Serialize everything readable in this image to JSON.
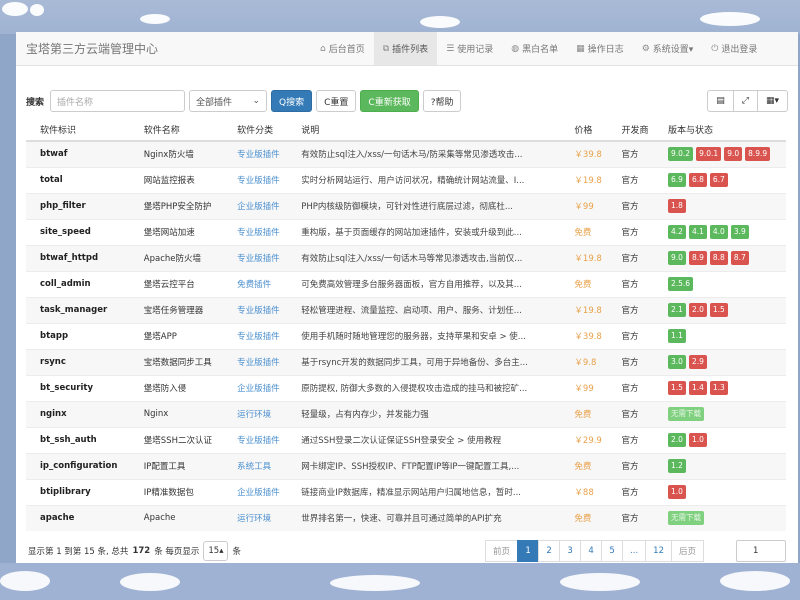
{
  "app": {
    "title": "宝塔第三方云端管理中心"
  },
  "nav": [
    {
      "icon": "home-icon",
      "glyph": "⌂",
      "label": "后台首页",
      "active": false
    },
    {
      "icon": "cube-icon",
      "glyph": "⧉",
      "label": "插件列表",
      "active": true
    },
    {
      "icon": "list-icon",
      "glyph": "☰",
      "label": "使用记录",
      "active": false
    },
    {
      "icon": "globe-icon",
      "glyph": "◍",
      "label": "黑白名单",
      "active": false
    },
    {
      "icon": "calendar-icon",
      "glyph": "▦",
      "label": "操作日志",
      "active": false
    },
    {
      "icon": "gear-icon",
      "glyph": "⚙",
      "label": "系统设置▾",
      "active": false
    },
    {
      "icon": "power-icon",
      "glyph": "⏻",
      "label": "退出登录",
      "active": false
    }
  ],
  "toolbar": {
    "search_label": "搜索",
    "search_placeholder": "插件名称",
    "filter_value": "全部插件",
    "search_button": "Q搜索",
    "reset_button": "C重置",
    "refresh_button": "C重新获取",
    "help_button": "?帮助"
  },
  "table": {
    "headers": [
      "软件标识",
      "软件名称",
      "软件分类",
      "说明",
      "价格",
      "开发商",
      "版本与状态"
    ],
    "rows": [
      {
        "id": "btwaf",
        "name": "Nginx防火墙",
        "category": "专业版插件",
        "desc": "有效防止sql注入/xss/一句话木马/防采集等常见渗透攻击...",
        "price": "￥39.8",
        "dev": "官方",
        "versions": [
          [
            "9.0.2",
            "g"
          ],
          [
            "9.0.1",
            "r"
          ],
          [
            "9.0",
            "r"
          ],
          [
            "8.9.9",
            "r"
          ]
        ]
      },
      {
        "id": "total",
        "name": "网站监控报表",
        "category": "专业版插件",
        "desc": "实时分析网站运行、用户访问状况，精确统计网站流量、I...",
        "price": "￥19.8",
        "dev": "官方",
        "versions": [
          [
            "6.9",
            "g"
          ],
          [
            "6.8",
            "r"
          ],
          [
            "6.7",
            "r"
          ]
        ]
      },
      {
        "id": "php_filter",
        "name": "堡塔PHP安全防护",
        "category": "企业版插件",
        "desc": "PHP内核级防御模块，可针对性进行底层过滤，彻底杜...",
        "price": "￥99",
        "dev": "官方",
        "versions": [
          [
            "1.8",
            "r"
          ]
        ]
      },
      {
        "id": "site_speed",
        "name": "堡塔网站加速",
        "category": "专业版插件",
        "desc": "重构版，基于页面缓存的网站加速插件，安装或升级到此...",
        "price": "免费",
        "dev": "官方",
        "versions": [
          [
            "4.2",
            "g"
          ],
          [
            "4.1",
            "g"
          ],
          [
            "4.0",
            "g"
          ],
          [
            "3.9",
            "g"
          ]
        ]
      },
      {
        "id": "btwaf_httpd",
        "name": "Apache防火墙",
        "category": "专业版插件",
        "desc": "有效防止sql注入/xss/一句话木马等常见渗透攻击,当前仅...",
        "price": "￥19.8",
        "dev": "官方",
        "versions": [
          [
            "9.0",
            "g"
          ],
          [
            "8.9",
            "r"
          ],
          [
            "8.8",
            "r"
          ],
          [
            "8.7",
            "r"
          ]
        ]
      },
      {
        "id": "coll_admin",
        "name": "堡塔云控平台",
        "category": "免费插件",
        "desc": "可免费高效管理多台服务器面板，官方自用推荐，以及其...",
        "price": "免费",
        "dev": "官方",
        "versions": [
          [
            "2.5.6",
            "g"
          ]
        ]
      },
      {
        "id": "task_manager",
        "name": "宝塔任务管理器",
        "category": "专业版插件",
        "desc": "轻松管理进程、流量监控、启动项、用户、服务、计划任...",
        "price": "￥19.8",
        "dev": "官方",
        "versions": [
          [
            "2.1",
            "g"
          ],
          [
            "2.0",
            "r"
          ],
          [
            "1.5",
            "r"
          ]
        ]
      },
      {
        "id": "btapp",
        "name": "堡塔APP",
        "category": "专业版插件",
        "desc": "使用手机随时随地管理您的服务器，支持苹果和安卓 > 使...",
        "price": "￥39.8",
        "dev": "官方",
        "versions": [
          [
            "1.1",
            "g"
          ]
        ]
      },
      {
        "id": "rsync",
        "name": "宝塔数据同步工具",
        "category": "专业版插件",
        "desc": "基于rsync开发的数据同步工具，可用于异地备份、多台主...",
        "price": "￥9.8",
        "dev": "官方",
        "versions": [
          [
            "3.0",
            "g"
          ],
          [
            "2.9",
            "r"
          ]
        ]
      },
      {
        "id": "bt_security",
        "name": "堡塔防入侵",
        "category": "企业版插件",
        "desc": "原防提权, 防御大多数的入侵提权攻击造成的挂马和被挖矿...",
        "price": "￥99",
        "dev": "官方",
        "versions": [
          [
            "1.5",
            "r"
          ],
          [
            "1.4",
            "r"
          ],
          [
            "1.3",
            "r"
          ]
        ]
      },
      {
        "id": "nginx",
        "name": "Nginx",
        "category": "运行环境",
        "desc": "轻量级，占有内存少，并发能力强",
        "price": "免费",
        "dev": "官方",
        "versions": [
          [
            "无需下载",
            "dl"
          ]
        ]
      },
      {
        "id": "bt_ssh_auth",
        "name": "堡塔SSH二次认证",
        "category": "专业版插件",
        "desc": "通过SSH登录二次认证保证SSH登录安全 > 使用教程",
        "price": "￥29.9",
        "dev": "官方",
        "versions": [
          [
            "2.0",
            "g"
          ],
          [
            "1.0",
            "r"
          ]
        ]
      },
      {
        "id": "ip_configuration",
        "name": "IP配置工具",
        "category": "系统工具",
        "desc": "网卡绑定IP、SSH授权IP、FTP配置IP等IP一键配置工具,...",
        "price": "免费",
        "dev": "官方",
        "versions": [
          [
            "1.2",
            "g"
          ]
        ]
      },
      {
        "id": "btiplibrary",
        "name": "IP精准数据包",
        "category": "企业版插件",
        "desc": "链接商业IP数据库，精准显示网站用户归属地信息，暂时...",
        "price": "￥88",
        "dev": "官方",
        "versions": [
          [
            "1.0",
            "r"
          ]
        ]
      },
      {
        "id": "apache",
        "name": "Apache",
        "category": "运行环境",
        "desc": "世界排名第一，快速、可靠并且可通过简单的API扩充",
        "price": "免费",
        "dev": "官方",
        "versions": [
          [
            "无需下载",
            "dl"
          ]
        ]
      }
    ]
  },
  "pagination": {
    "summary_prefix": "显示第 1 到第 15 条, 总共",
    "total": "172",
    "summary_suffix": "条  每页显示",
    "page_size": "15▴",
    "page_size_suffix": "条",
    "prev": "前页",
    "pages": [
      "1",
      "2",
      "3",
      "4",
      "5",
      "...",
      "12"
    ],
    "next": "后页",
    "jump_value": "1"
  }
}
